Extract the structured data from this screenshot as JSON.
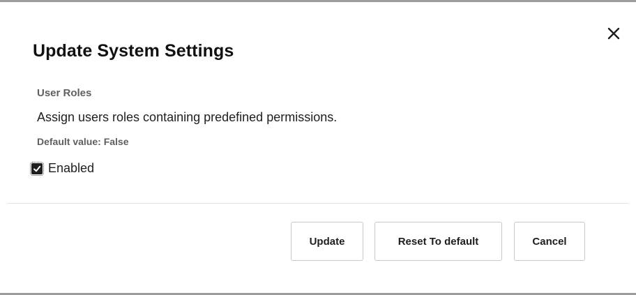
{
  "dialog": {
    "title": "Update System Settings",
    "close_icon": "close-icon"
  },
  "setting": {
    "name": "User Roles",
    "description": "Assign users roles containing predefined permissions.",
    "default_value": "Default value: False",
    "enabled_label": "Enabled",
    "enabled": true
  },
  "actions": {
    "update_label": "Update",
    "reset_label": "Reset To default",
    "cancel_label": "Cancel"
  },
  "colors": {
    "title_text": "#111111",
    "muted_text": "#5f5f5f",
    "checkbox_fill": "#1f1f1f",
    "button_border": "#c9c9c9"
  }
}
